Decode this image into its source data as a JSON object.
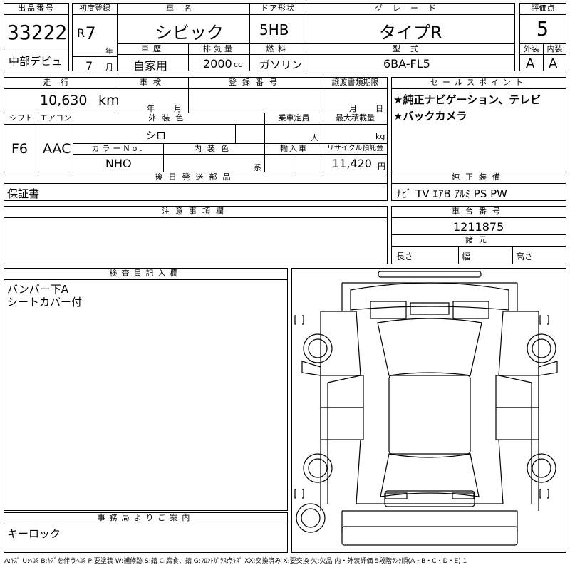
{
  "lot": {
    "label": "出品番号",
    "value": "33222",
    "venue": "中部デビュ"
  },
  "first_reg": {
    "label": "初度登録",
    "era": "R",
    "year": "7",
    "year_unit": "年",
    "month": "7",
    "month_unit": "月"
  },
  "car_name": {
    "label": "車名",
    "value": "シビック"
  },
  "door": {
    "label": "ドア形状",
    "value": "5HB"
  },
  "grade": {
    "label": "グレード",
    "value": "タイプR"
  },
  "score": {
    "label": "評価点",
    "value": "5",
    "ext_label": "外装",
    "int_label": "内装",
    "ext": "A",
    "int": "A"
  },
  "history": {
    "label": "車歴",
    "value": "自家用"
  },
  "displacement": {
    "label": "排気量",
    "value": "2000",
    "unit": "cc"
  },
  "fuel": {
    "label": "燃料",
    "value": "ガソリン"
  },
  "model": {
    "label": "型式",
    "value": "6BA-FL5"
  },
  "mileage": {
    "label": "走行",
    "value": "10,630",
    "unit": "km"
  },
  "inspection": {
    "label": "車検",
    "year_unit": "年",
    "month_unit": "月"
  },
  "reg_no": {
    "label": "登録番号"
  },
  "transfer": {
    "label": "譲渡書類期限",
    "month_unit": "月",
    "day_unit": "日"
  },
  "sales_points": {
    "label": "セールスポイント",
    "items": [
      "★純正ナビゲーション、テレビ",
      "★バックカメラ"
    ]
  },
  "shift": {
    "label": "シフト",
    "value": "F6"
  },
  "ac": {
    "label": "エアコン",
    "value": "AAC"
  },
  "ext_color": {
    "label": "外装色",
    "value": "シロ"
  },
  "capacity": {
    "label": "乗車定員",
    "unit": "人"
  },
  "max_load": {
    "label": "最大積載量",
    "unit": "kg"
  },
  "color_no": {
    "label": "カラーNo.",
    "value": "NHO"
  },
  "int_color": {
    "label": "内装色",
    "unit": "系"
  },
  "import": {
    "label": "輸入車"
  },
  "recycle": {
    "label": "リサイクル預託金",
    "value": "11,420",
    "unit": "円"
  },
  "later_parts": {
    "label": "後日発送部品",
    "value": "保証書"
  },
  "genuine": {
    "label": "純正装備",
    "value": "ﾅﾋﾞ TV ｴｱB ｱﾙﾐ PS PW"
  },
  "notes": {
    "label": "注意事項欄"
  },
  "chassis": {
    "label": "車台番号",
    "value": "1211875"
  },
  "dims": {
    "label": "諸元",
    "length": "長さ",
    "width": "幅",
    "height": "高さ"
  },
  "inspector": {
    "label": "検査員記入欄",
    "lines": [
      "バンパー下A",
      "シートカバー付"
    ]
  },
  "office": {
    "label": "事務局よりご案内",
    "value": "キーロック"
  },
  "legend": "A:ｷｽﾞ U:ﾍｺﾐ B:ｷｽﾞを伴うﾍｺﾐ P:要塗装 W:補修跡 S:錆 C:腐食、錆 G:ﾌﾛﾝﾄｶﾞﾗｽ点ｷｽﾞ XX:交換済み X:要交換 欠:欠品 内・外装評価 5段階ﾗﾝｸ順(A・B・C・D・E) 1"
}
